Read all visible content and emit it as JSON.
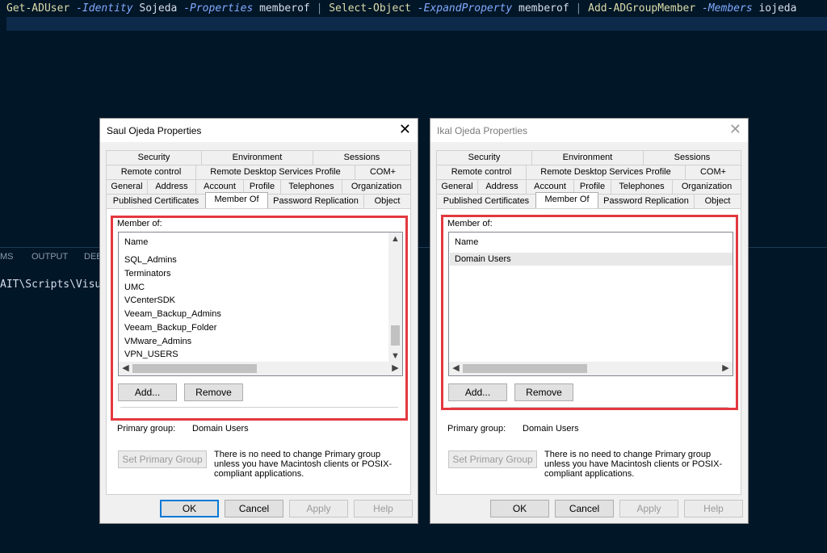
{
  "terminal": {
    "cmd1": "Get-ADUser",
    "p1": "-Identity",
    "v1": "Sojeda",
    "p2": "-Properties",
    "v2": "memberof",
    "pipe1": "|",
    "cmd2": "Select-Object",
    "p3": "-ExpandProperty",
    "v3": "memberof",
    "pipe2": "|",
    "cmd3": "Add-ADGroupMember",
    "p4": "-Members",
    "v4": "iojeda"
  },
  "panel": {
    "tabs": [
      "MS",
      "OUTPUT",
      "DEB"
    ],
    "path": "AIT\\Scripts\\Visual"
  },
  "dialog1": {
    "title": "Saul Ojeda Properties",
    "close": "✕",
    "tabs_row1": [
      "Security",
      "Environment",
      "Sessions"
    ],
    "tabs_row2": [
      "Remote control",
      "Remote Desktop Services Profile",
      "COM+"
    ],
    "tabs_row3": [
      "General",
      "Address",
      "Account",
      "Profile",
      "Telephones",
      "Organization"
    ],
    "tabs_row4": [
      "Published Certificates",
      "Member Of",
      "Password Replication",
      "Object"
    ],
    "group_label": "Member of:",
    "list_header": "Name",
    "items": [
      "SQL_Admins",
      "Terminators",
      "UMC",
      "VCenterSDK",
      "Veeam_Backup_Admins",
      "Veeam_Backup_Folder",
      "VMware_Admins",
      "VPN_USERS"
    ],
    "add": "Add...",
    "remove": "Remove",
    "primary_label": "Primary group:",
    "primary_value": "Domain Users",
    "set_primary": "Set Primary Group",
    "note": "There is no need to change Primary group unless you have Macintosh clients or POSIX-compliant applications.",
    "ok": "OK",
    "cancel": "Cancel",
    "apply": "Apply",
    "help": "Help"
  },
  "dialog2": {
    "title": "Ikal Ojeda Properties",
    "close": "✕",
    "tabs_row1": [
      "Security",
      "Environment",
      "Sessions"
    ],
    "tabs_row2": [
      "Remote control",
      "Remote Desktop Services Profile",
      "COM+"
    ],
    "tabs_row3": [
      "General",
      "Address",
      "Account",
      "Profile",
      "Telephones",
      "Organization"
    ],
    "tabs_row4": [
      "Published Certificates",
      "Member Of",
      "Password Replication",
      "Object"
    ],
    "group_label": "Member of:",
    "list_header": "Name",
    "items": [
      "Domain Users"
    ],
    "add": "Add...",
    "remove": "Remove",
    "primary_label": "Primary group:",
    "primary_value": "Domain Users",
    "set_primary": "Set Primary Group",
    "note": "There is no need to change Primary group unless you have Macintosh clients or POSIX-compliant applications.",
    "ok": "OK",
    "cancel": "Cancel",
    "apply": "Apply",
    "help": "Help"
  },
  "colors": {
    "terminal_bg": "#011627",
    "highlight": "#e3383f",
    "default_button_border": "#0078d7"
  }
}
